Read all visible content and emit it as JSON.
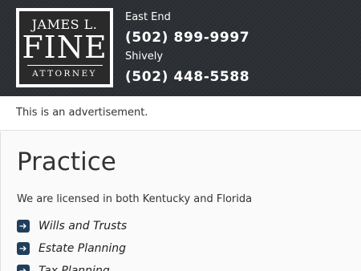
{
  "header": {
    "logo": {
      "line1": "JAMES L.",
      "line2": "FINE",
      "line3": "ATTORNEY"
    },
    "offices": [
      {
        "label": "East End",
        "phone": "(502) 899-9997"
      },
      {
        "label": "Shively",
        "phone": "(502) 448-5588"
      }
    ]
  },
  "disclaimer": "This is an advertisement.",
  "main": {
    "title": "Practice",
    "intro": "We are licensed in both Kentucky and Florida",
    "practice_areas": [
      "Wills and Trusts",
      "Estate Planning",
      "Tax Planning"
    ]
  },
  "icons": {
    "bullet": "arrow-right-icon"
  },
  "colors": {
    "header_bg": "#2b2f33",
    "bullet_bg": "#1f3f5c"
  }
}
